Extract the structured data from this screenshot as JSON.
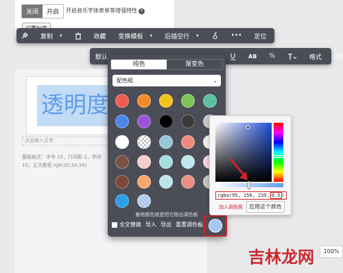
{
  "settings": {
    "toggle_off": "关闭",
    "toggle_on": "开启",
    "music_label": "开启音乐字体表单等增强特性",
    "help_icon": "?",
    "tag_button": "设置标签"
  },
  "toolbar1": {
    "items": [
      "复制",
      "收藏",
      "变换模板",
      "后插空行",
      "定位"
    ],
    "more": "•••"
  },
  "toolbar2": {
    "default_label": "默认",
    "ab_label": "AB",
    "percent_label": "%",
    "format_label": "格式",
    "spacing_label": "间距"
  },
  "canvas": {
    "title_text": "透明度",
    "caption_placeholder": "点击输入文字",
    "format_line1": "基础格式：字号 15，行间距 2，字间",
    "format_line2": "15，正文颜色 rgb(35,34,34)"
  },
  "picker": {
    "tab_solid": "纯色",
    "tab_gradient": "渐变色",
    "group_select": "配色組",
    "swatches": [
      {
        "color": "#f05b52"
      },
      {
        "color": "#f28c2a"
      },
      {
        "color": "#f5c418"
      },
      {
        "color": "#7dc45a"
      },
      {
        "color": "#5bbfa0"
      },
      {
        "color": "#4d87e8"
      },
      {
        "color": "#9a55d6"
      },
      {
        "color": "#000000"
      },
      {
        "color": "#3a3a3a"
      },
      {
        "color": "#c8c8c8"
      },
      {
        "color": "#ffffff"
      },
      {
        "color": "clear"
      },
      {
        "color": "#98c8d6"
      },
      {
        "color": "#f08a7c"
      },
      {
        "color": "#eeeeee"
      },
      {
        "color": "#7a5246"
      },
      {
        "color": "#f6cdd0"
      },
      {
        "color": "#a6dfe0"
      },
      {
        "color": "#bce8ee"
      },
      {
        "color": "#f6cfd6"
      },
      {
        "color": "#7a4838"
      },
      {
        "color": "#f6a86c"
      },
      {
        "color": "#bfe4ec"
      },
      {
        "color": "#ea8e86"
      },
      {
        "color": "#c4c4c4"
      },
      {
        "color": "#2d9ee8"
      },
      {
        "color": "clear-blue"
      }
    ],
    "hint": "删除颜色就是把它拖出调色板",
    "replace_all": "全文替换",
    "import": "导入",
    "export": "导出",
    "reset": "重置调色板",
    "current_color": "#a6c6f3"
  },
  "advanced": {
    "rgba_prefix": "rgba(95, 156, 239,",
    "alpha_value": "0.5",
    "rgba_suffix": ")",
    "add_to_palette": "加入调色板",
    "apply_color": "应用这个颜色"
  },
  "watermark": "吉林龙网",
  "zoom": "100%"
}
